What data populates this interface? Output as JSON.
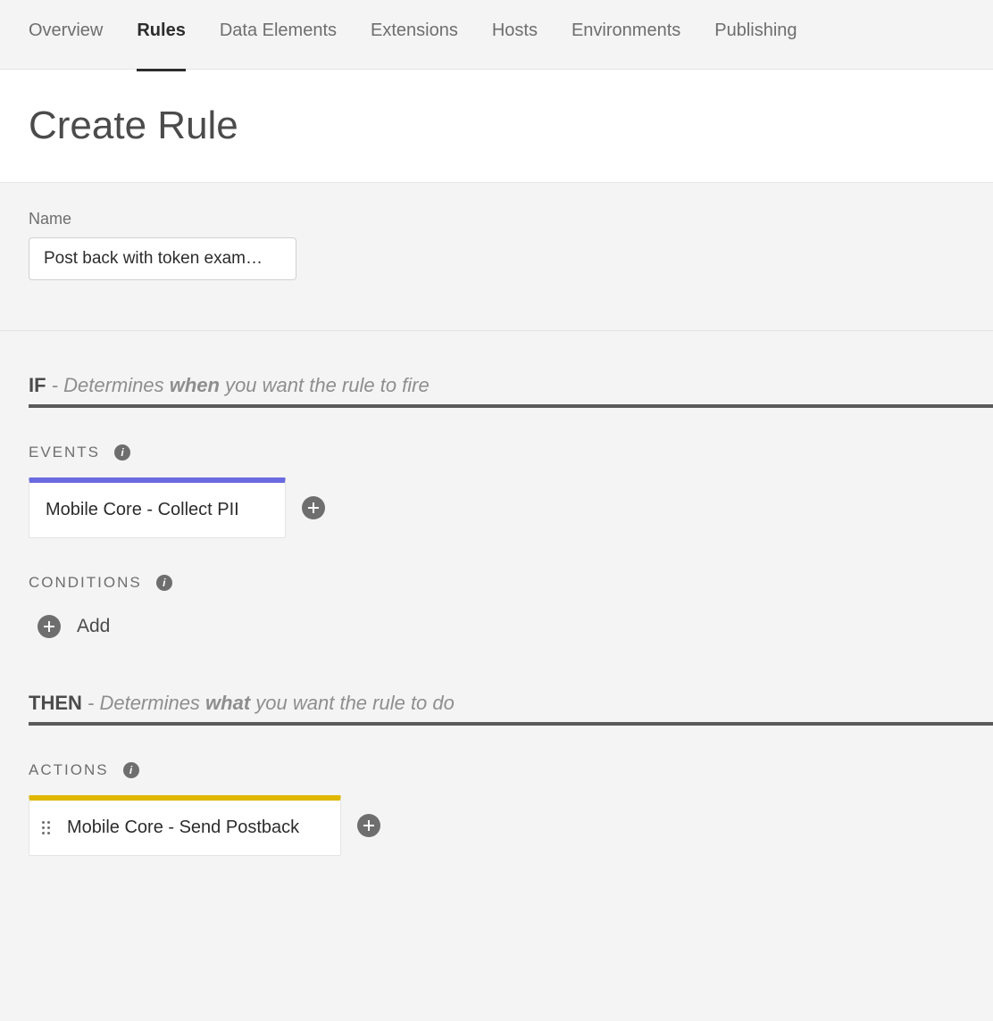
{
  "tabs": {
    "overview": "Overview",
    "rules": "Rules",
    "data_elements": "Data Elements",
    "extensions": "Extensions",
    "hosts": "Hosts",
    "environments": "Environments",
    "publishing": "Publishing",
    "active": "rules"
  },
  "page_title": "Create Rule",
  "name_field": {
    "label": "Name",
    "value": "Post back with token exam…"
  },
  "if_line": {
    "kw": "IF",
    "dash": " - ",
    "pre": "Determines ",
    "bold": "when",
    "post": " you want the rule to fire"
  },
  "events": {
    "heading": "EVENTS",
    "card_text": "Mobile Core - Collect PII"
  },
  "conditions": {
    "heading": "CONDITIONS",
    "add_label": "Add"
  },
  "then_line": {
    "kw": "THEN",
    "dash": " - ",
    "pre": "Determines ",
    "bold": "what",
    "post": " you want the rule to do"
  },
  "actions": {
    "heading": "ACTIONS",
    "card_text": "Mobile Core - Send Postback"
  }
}
